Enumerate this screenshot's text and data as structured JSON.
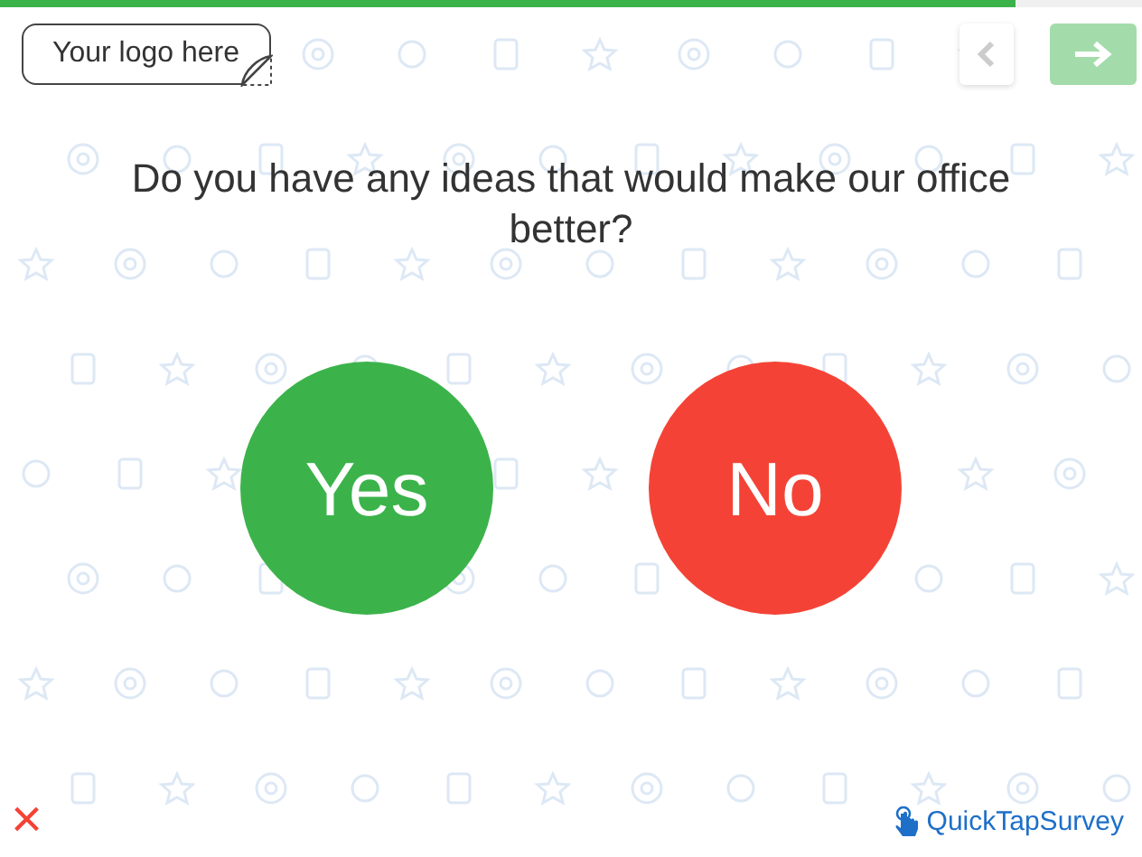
{
  "progress": {
    "level": 0.89
  },
  "logo": {
    "text": "Your logo here"
  },
  "nav": [
    {
      "kind": "back",
      "disabled": true
    },
    {
      "kind": "next",
      "disabled": true
    }
  ],
  "question": "Do you have any ideas that would make our office better?",
  "choices": [
    {
      "label": "Yes",
      "color": "#3bb34a"
    },
    {
      "label": "No",
      "color": "#f44336"
    }
  ],
  "close": {
    "text": "×"
  },
  "brand": "QuickTapSurvey"
}
